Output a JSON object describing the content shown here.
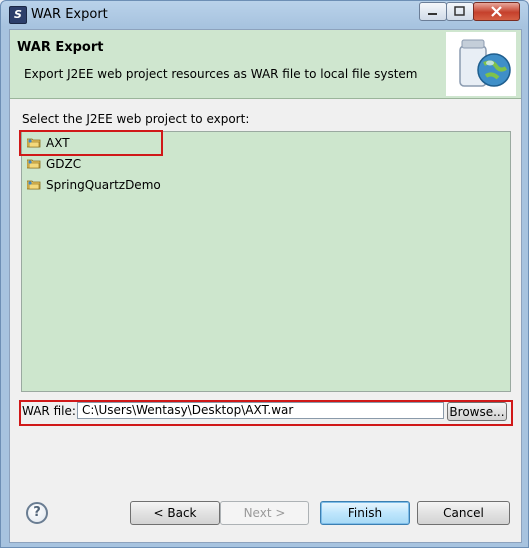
{
  "window": {
    "title": "WAR Export"
  },
  "banner": {
    "title": "WAR Export",
    "description": "Export J2EE web project resources as WAR file to local file system"
  },
  "project_select": {
    "label": "Select the J2EE web project to export:",
    "items": [
      {
        "label": "AXT",
        "highlighted": true
      },
      {
        "label": "GDZC"
      },
      {
        "label": "SpringQuartzDemo"
      }
    ]
  },
  "war_file": {
    "label": "WAR file:",
    "value": "C:\\Users\\Wentasy\\Desktop\\AXT.war",
    "browse_label": "Browse..."
  },
  "buttons": {
    "help_glyph": "?",
    "back": "< Back",
    "next": "Next >",
    "finish": "Finish",
    "cancel": "Cancel"
  },
  "colors": {
    "highlight": "#d01818",
    "banner_bg": "#cfe6cf",
    "tree_bg": "#cde6cd"
  }
}
